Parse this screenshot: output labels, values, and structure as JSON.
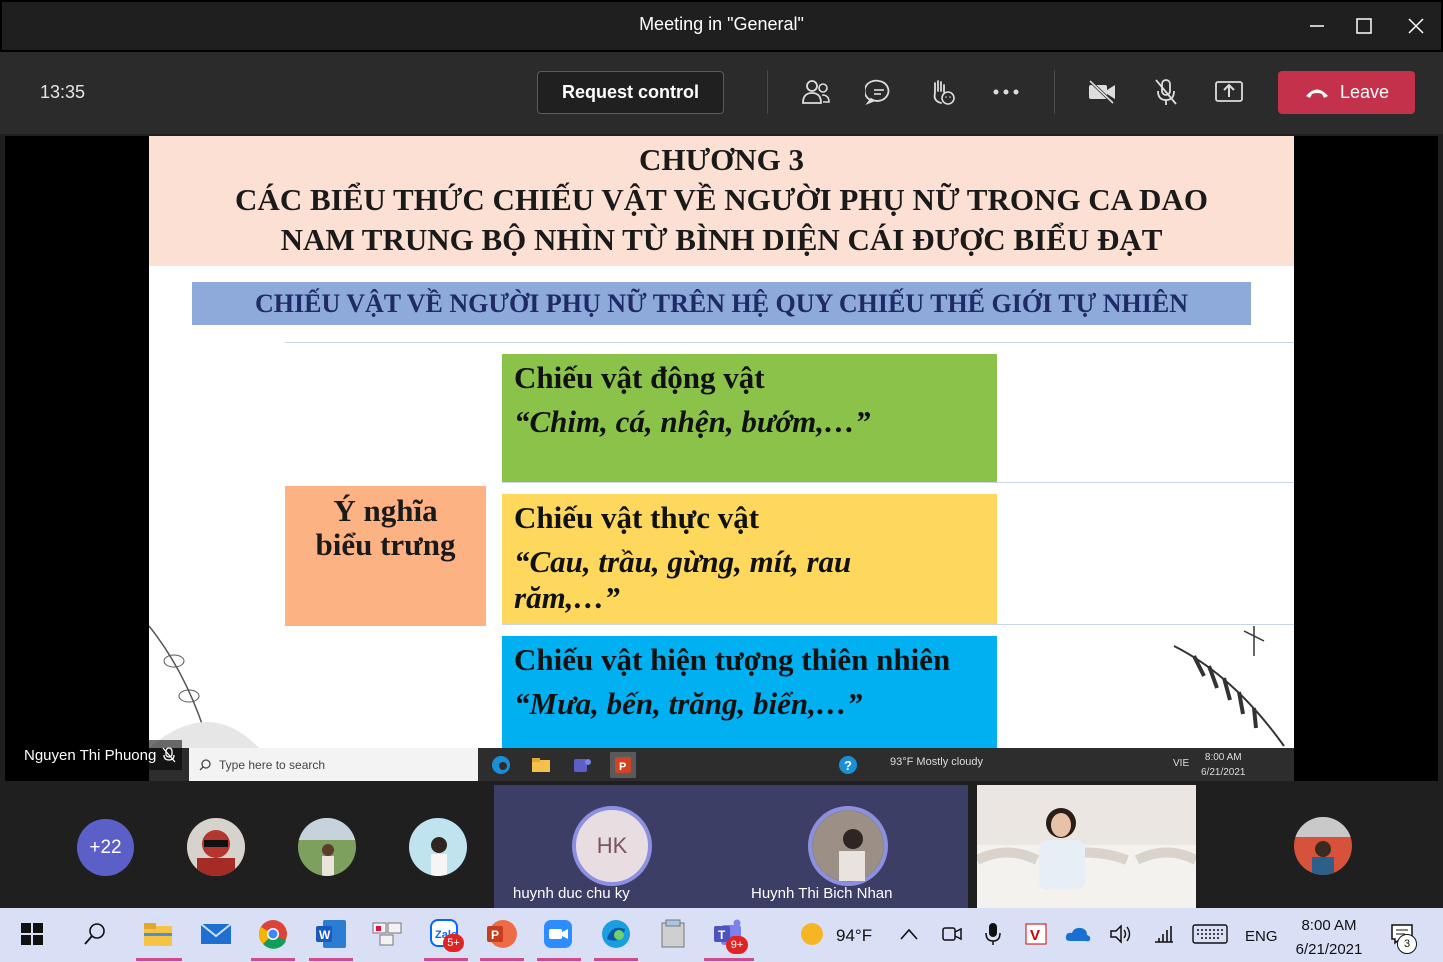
{
  "window": {
    "title": "Meeting in \"General\""
  },
  "toolbar": {
    "elapsed": "13:35",
    "request_control_label": "Request control",
    "leave_label": "Leave"
  },
  "slide": {
    "chapter": "CHƯƠNG 3",
    "title_line1": "CÁC BIỂU THỨC CHIẾU VẬT VỀ NGƯỜI PHỤ NỮ TRONG CA DAO",
    "title_line2": "NAM TRUNG BỘ NHÌN TỪ BÌNH DIỆN CÁI ĐƯỢC BIỂU ĐẠT",
    "subtitle": "CHIẾU VẬT VỀ NGƯỜI PHỤ NỮ TRÊN HỆ QUY CHIẾU THẾ GIỚI TỰ NHIÊN",
    "center_label_line1": "Ý nghĩa",
    "center_label_line2": "biểu trưng",
    "boxes": [
      {
        "heading": "Chiếu vật động vật",
        "quote": "“Chim, cá, nhện, bướm,…”",
        "color": "#8bc34a"
      },
      {
        "heading": "Chiếu vật thực vật",
        "quote": "“Cau, trầu, gừng, mít, rau răm,…”",
        "color": "#fdd85d"
      },
      {
        "heading": "Chiếu vật hiện tượng thiên nhiên",
        "quote": "“Mưa, bến, trăng, biển,…”",
        "color": "#00b0f0"
      }
    ]
  },
  "remote_taskbar": {
    "search_placeholder": "Type here to search",
    "weather": "93°F  Mostly cloudy",
    "lang": "VIE",
    "time": "8:00 AM",
    "date": "6/21/2021"
  },
  "presenter": {
    "name": "Nguyen Thi Phuong"
  },
  "gallery": {
    "more_count": "+22",
    "tiles": [
      {
        "initials": "HK",
        "name": "huynh duc chu ky"
      },
      {
        "name": "Huynh Thi Bich Nhan"
      }
    ]
  },
  "taskbar": {
    "zalo_badge": "5+",
    "teams_badge": "9+",
    "temperature": "94°F",
    "lang": "ENG",
    "time": "8:00 AM",
    "date": "6/21/2021",
    "notifications": "3"
  },
  "colors": {
    "leave": "#c4314b",
    "accent": "#5b5fc7"
  }
}
